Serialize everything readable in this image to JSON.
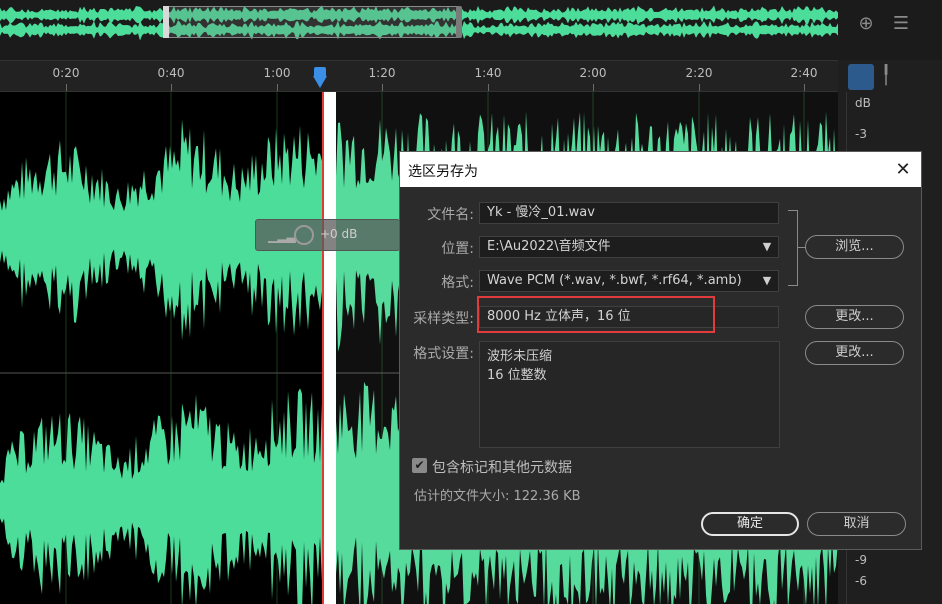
{
  "timeline": {
    "ticks": [
      "0:20",
      "0:40",
      "1:00",
      "1:20",
      "1:40",
      "2:00",
      "2:20",
      "2:40"
    ]
  },
  "hud": {
    "gain": "+0 dB"
  },
  "db_scale": {
    "unit": "dB",
    "labels": [
      "-3",
      "-9",
      "-6"
    ]
  },
  "dialog": {
    "title": "选区另存为",
    "close_glyph": "✕",
    "filename": {
      "label": "文件名:",
      "value": "Yk - 慢冷_01.wav"
    },
    "location": {
      "label": "位置:",
      "value": "E:\\Au2022\\音频文件"
    },
    "format": {
      "label": "格式:",
      "value": "Wave PCM (*.wav, *.bwf, *.rf64, *.amb)"
    },
    "sample_type": {
      "label": "采样类型:",
      "value": "8000 Hz 立体声，16 位"
    },
    "format_settings": {
      "label": "格式设置:",
      "lines": [
        "波形未压缩",
        "16 位整数"
      ]
    },
    "browse_button": "浏览...",
    "change_button_1": "更改...",
    "change_button_2": "更改...",
    "include_markers": {
      "label": "包含标记和其他元数据",
      "checked": true
    },
    "estimated_size": "估计的文件大小: 122.36 KB",
    "ok_button": "确定",
    "cancel_button": "取消"
  },
  "colors": {
    "waveform": "#4ddd9a",
    "playhead": "#3a8ee6",
    "highlight": "#e23b3b"
  }
}
